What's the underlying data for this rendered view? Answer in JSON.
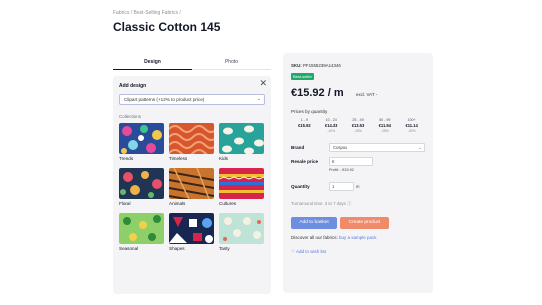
{
  "breadcrumb": "Fabrics / Best-Selling Fabrics /",
  "product_title": "Classic Cotton 145",
  "tabs": [
    {
      "label": "Design"
    },
    {
      "label": "Photo"
    }
  ],
  "add_design": {
    "title": "Add design",
    "select_value": "Clipart patterns (+12% to product price)",
    "collections_label": "Collections",
    "collections": [
      {
        "label": "Trends"
      },
      {
        "label": "Timeless"
      },
      {
        "label": "Kids"
      },
      {
        "label": "Floral"
      },
      {
        "label": "Animals"
      },
      {
        "label": "Cultures"
      },
      {
        "label": "Seasonal"
      },
      {
        "label": "Shapes"
      },
      {
        "label": "Tasty"
      }
    ]
  },
  "product": {
    "sku_label": "SKU:",
    "sku_value": "PF1555239A14346",
    "badge": "Best-seller",
    "price": "€15.92 / m",
    "vat": "excl. VAT -",
    "qty_label": "Prices by quantity",
    "qty_tiers": [
      {
        "range": "1 - 9",
        "price": "€15.92",
        "discount": ""
      },
      {
        "range": "10 - 24",
        "price": "€14.33",
        "discount": "-10%"
      },
      {
        "range": "25 - 49",
        "price": "€13.53",
        "discount": "-15%"
      },
      {
        "range": "50 - 99",
        "price": "€11.94",
        "discount": "-25%"
      },
      {
        "range": "100+",
        "price": "€11.14",
        "discount": "-30%"
      }
    ],
    "brand_label": "Brand",
    "brand_value": "Cospox",
    "resale_label": "Resale price",
    "resale_value": "€",
    "profit": "Profit: - €15.92",
    "quantity_label": "Quantity",
    "quantity_value": "1",
    "unit": "m",
    "turnaround": "Turnaround time: 3 to 7 days ⓘ",
    "basket_button": "Add to basket",
    "create_button": "Create product",
    "discover_text": "Discover all our fabrics:",
    "discover_link": "buy a sample pack",
    "wishlist": "♡  Add to wish list"
  },
  "colors": {
    "accent_blue": "#6e8fe0",
    "accent_orange": "#f08a6b",
    "badge_green": "#1faa6b"
  }
}
